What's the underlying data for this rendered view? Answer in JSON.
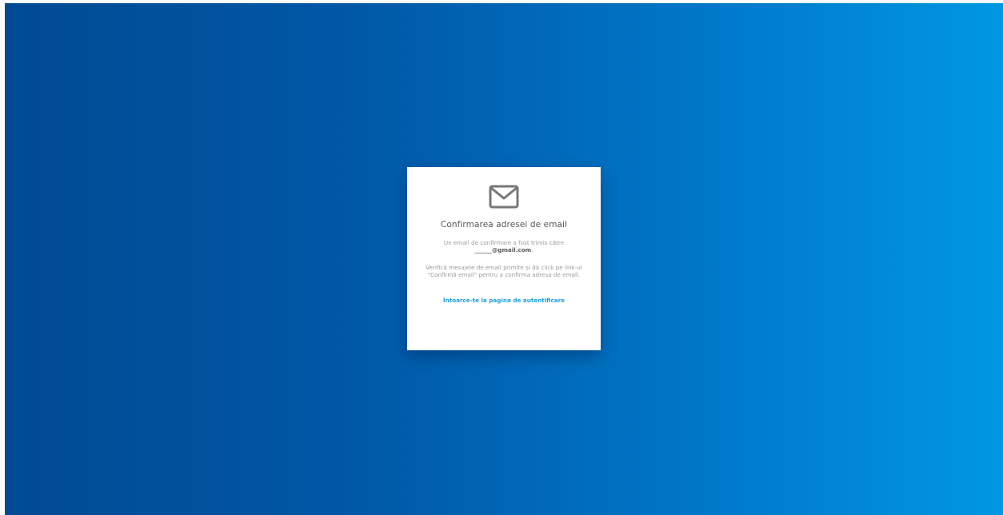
{
  "card": {
    "icon": "envelope-icon",
    "title": "Confirmarea adresei de email",
    "sent_prefix": "Un email de confirmare a fost trimis către",
    "email": "______@gmail.com",
    "sent_suffix": ".",
    "instructions": "Verifică mesajele de email primite și dă click pe link-ul \"Confirmă email\" pentru a confirma adresa de email.",
    "back_link": "Întoarce-te la pagina de autentificare"
  },
  "colors": {
    "gradient_start": "#004a93",
    "gradient_end": "#0097e2",
    "link": "#1a9ee0",
    "icon": "#777777"
  }
}
